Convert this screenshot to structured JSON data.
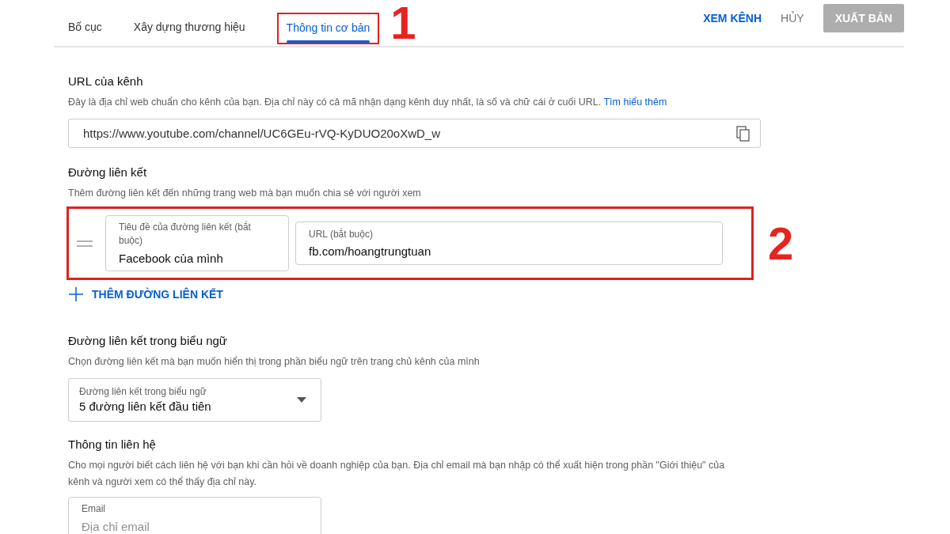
{
  "tabs": [
    {
      "label": "Bố cục",
      "selected": false
    },
    {
      "label": "Xây dựng thương hiệu",
      "selected": false
    },
    {
      "label": "Thông tin cơ bản",
      "selected": true,
      "annotation": "1"
    }
  ],
  "header_actions": [
    {
      "label": "XEM KÊNH",
      "kind": "link"
    },
    {
      "label": "HỦY",
      "kind": "text"
    },
    {
      "label": "XUẤT BẢN",
      "kind": "primary",
      "disabled": true
    }
  ],
  "channel_url": {
    "title": "URL của kênh",
    "description": "Đây là địa chỉ web chuẩn cho kênh của bạn. Địa chỉ này có cả mã nhận dạng kênh duy nhất, là số và chữ cái ở cuối URL.",
    "learn_more": "Tìm hiểu thêm",
    "value": "https://www.youtube.com/channel/UC6GEu-rVQ-KyDUO20oXwD_w"
  },
  "links": {
    "title": "Đường liên kết",
    "description": "Thêm đường liên kết đến những trang web mà bạn muốn chia sẻ với người xem",
    "annotation": "2",
    "items": [
      {
        "title_label": "Tiêu đề của đường liên kết (bắt buộc)",
        "title_value": "Facebook của mình",
        "url_label": "URL (bắt buộc)",
        "url_value": "fb.com/hoangtrungtuan"
      }
    ],
    "add_button": "THÊM ĐƯỜNG LIÊN KẾT"
  },
  "banner_links": {
    "title": "Đường liên kết trong biểu ngữ",
    "description": "Chọn đường liên kết mà bạn muốn hiển thị trong phần biểu ngữ trên trang chủ kênh của mình",
    "select_label": "Đường liên kết trong biểu ngữ",
    "select_value": "5 đường liên kết đầu tiên"
  },
  "contact": {
    "title": "Thông tin liên hệ",
    "description": "Cho mọi người biết cách liên hệ với bạn khi cần hỏi về doanh nghiệp của bạn. Địa chỉ email mà bạn nhập có thể xuất hiện trong phần \"Giới thiệu\" của kênh và người xem có thể thấy địa chỉ này.",
    "email_label": "Email",
    "email_placeholder": "Địa chỉ email"
  }
}
